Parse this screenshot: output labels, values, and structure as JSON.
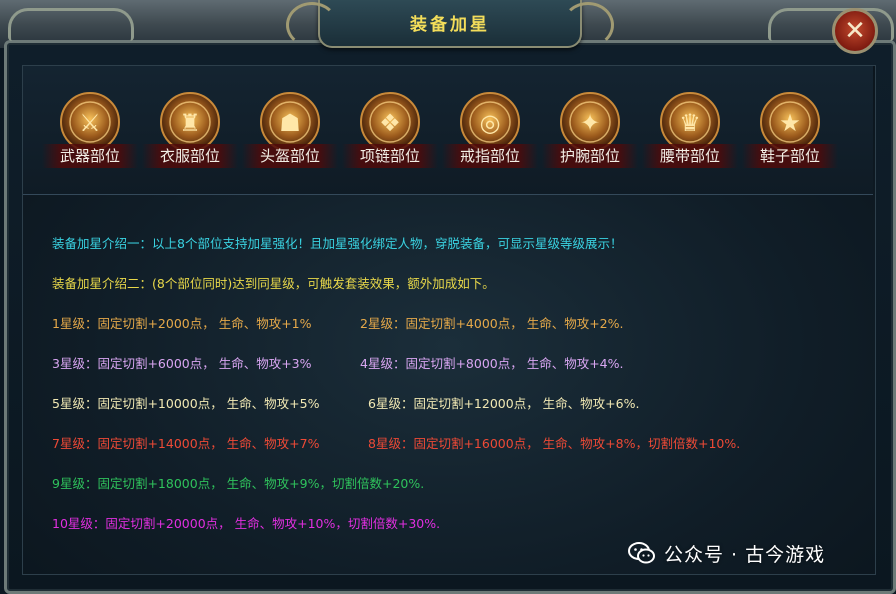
{
  "window": {
    "title": "装备加星",
    "close_icon": "close-x-icon"
  },
  "slots": [
    {
      "label": "武器部位",
      "icon": "weapon-emblem-icon"
    },
    {
      "label": "衣服部位",
      "icon": "armor-emblem-icon"
    },
    {
      "label": "头盔部位",
      "icon": "helmet-emblem-icon"
    },
    {
      "label": "项链部位",
      "icon": "necklace-emblem-icon"
    },
    {
      "label": "戒指部位",
      "icon": "ring-emblem-icon"
    },
    {
      "label": "护腕部位",
      "icon": "bracer-emblem-icon"
    },
    {
      "label": "腰带部位",
      "icon": "belt-emblem-icon"
    },
    {
      "label": "鞋子部位",
      "icon": "boots-emblem-icon"
    }
  ],
  "intro": {
    "line1": "装备加星介绍一：以上8个部位支持加星强化！且加星强化绑定人物，穿脱装备，可显示星级等级展示！",
    "line2": "装备加星介绍二：(8个部位同时)达到同星级，可触发套装效果，额外加成如下。"
  },
  "tiers": {
    "t1": "1星级：固定切割+2000点，  生命、物攻+1%",
    "t2": "2星级：固定切割+4000点，  生命、物攻+2%.",
    "t3": "3星级：固定切割+6000点，  生命、物攻+3%",
    "t4": "4星级：固定切割+8000点，  生命、物攻+4%.",
    "t5": "5星级：固定切割+10000点，  生命、物攻+5%",
    "t6": "6星级：固定切割+12000点，  生命、物攻+6%.",
    "t7": "7星级：固定切割+14000点，  生命、物攻+7%",
    "t8": "8星级：固定切割+16000点，  生命、物攻+8%，切割倍数+10%.",
    "t9": "9星级：固定切割+18000点，  生命、物攻+9%，切割倍数+20%.",
    "t10": "10星级：固定切割+20000点，  生命、物攻+10%，切割倍数+30%."
  },
  "watermark": {
    "text": "公众号 · 古今游戏",
    "icon": "wechat-icon"
  },
  "colors": {
    "title": "#f3dd5a",
    "intro1": "#3ad3e2",
    "intro2": "#e8d84a",
    "tier12": "#e6a94a",
    "tier34": "#d9a6f2",
    "tier56": "#f2e9b4",
    "tier78": "#ee4a36",
    "tier9": "#2fc25c",
    "tier10": "#e12fe0"
  }
}
